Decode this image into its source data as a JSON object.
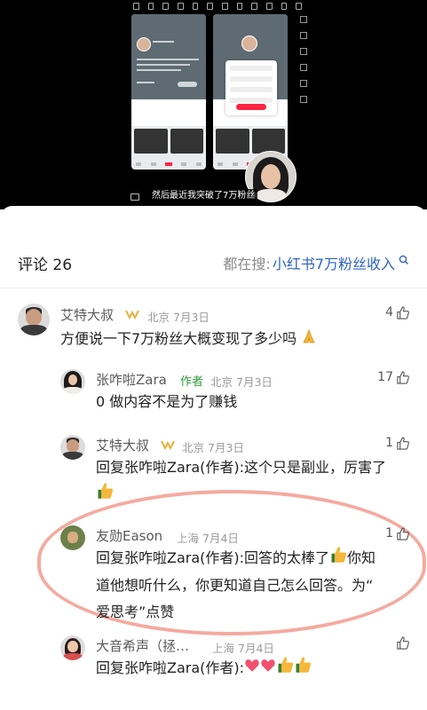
{
  "video": {
    "subtitle": "然后最近我突破了7万粉丝"
  },
  "comments_header": {
    "title": "评论 26",
    "searching_label": "都在搜:",
    "search_term": "小红书7万粉丝收入"
  },
  "comments": [
    {
      "name": "艾特大叔",
      "location": "北京",
      "date": "7月3日",
      "likes": "4",
      "text": "方便说一下7万粉丝大概变现了多少吗"
    },
    {
      "name": "张咋啦Zara",
      "author_tag": "作者",
      "location": "北京",
      "date": "7月3日",
      "likes": "17",
      "text": "0 做内容不是为了赚钱"
    },
    {
      "name": "艾特大叔",
      "location": "北京",
      "date": "7月3日",
      "likes": "1",
      "text_line1": "回复张咋啦Zara(作者):这个只是副业，厉害了"
    },
    {
      "name": "友勋Eason",
      "location": "上海",
      "date": "7月4日",
      "likes": "1",
      "text_line1a": "回复张咋啦Zara(作者):回答的太棒了",
      "text_line1b": "你知",
      "text_line2": "道他想听什么，你更知道自己怎么回答。为“",
      "text_line3": "爱思考”点赞"
    },
    {
      "name": "大音希声（拯…",
      "location": "上海",
      "date": "7月4日",
      "likes": "",
      "text": "回复张咋啦Zara(作者):"
    }
  ],
  "icons": [
    "thumbs-up-icon",
    "search-icon",
    "folded-hands-emoji",
    "heart-emoji",
    "thumbs-up-emoji",
    "creator-badge-icon"
  ],
  "colors": {
    "link": "#2f63c3",
    "author_tag": "#2f9a3a",
    "annotation": "#f39b8e",
    "brand_red": "#ff2442"
  }
}
